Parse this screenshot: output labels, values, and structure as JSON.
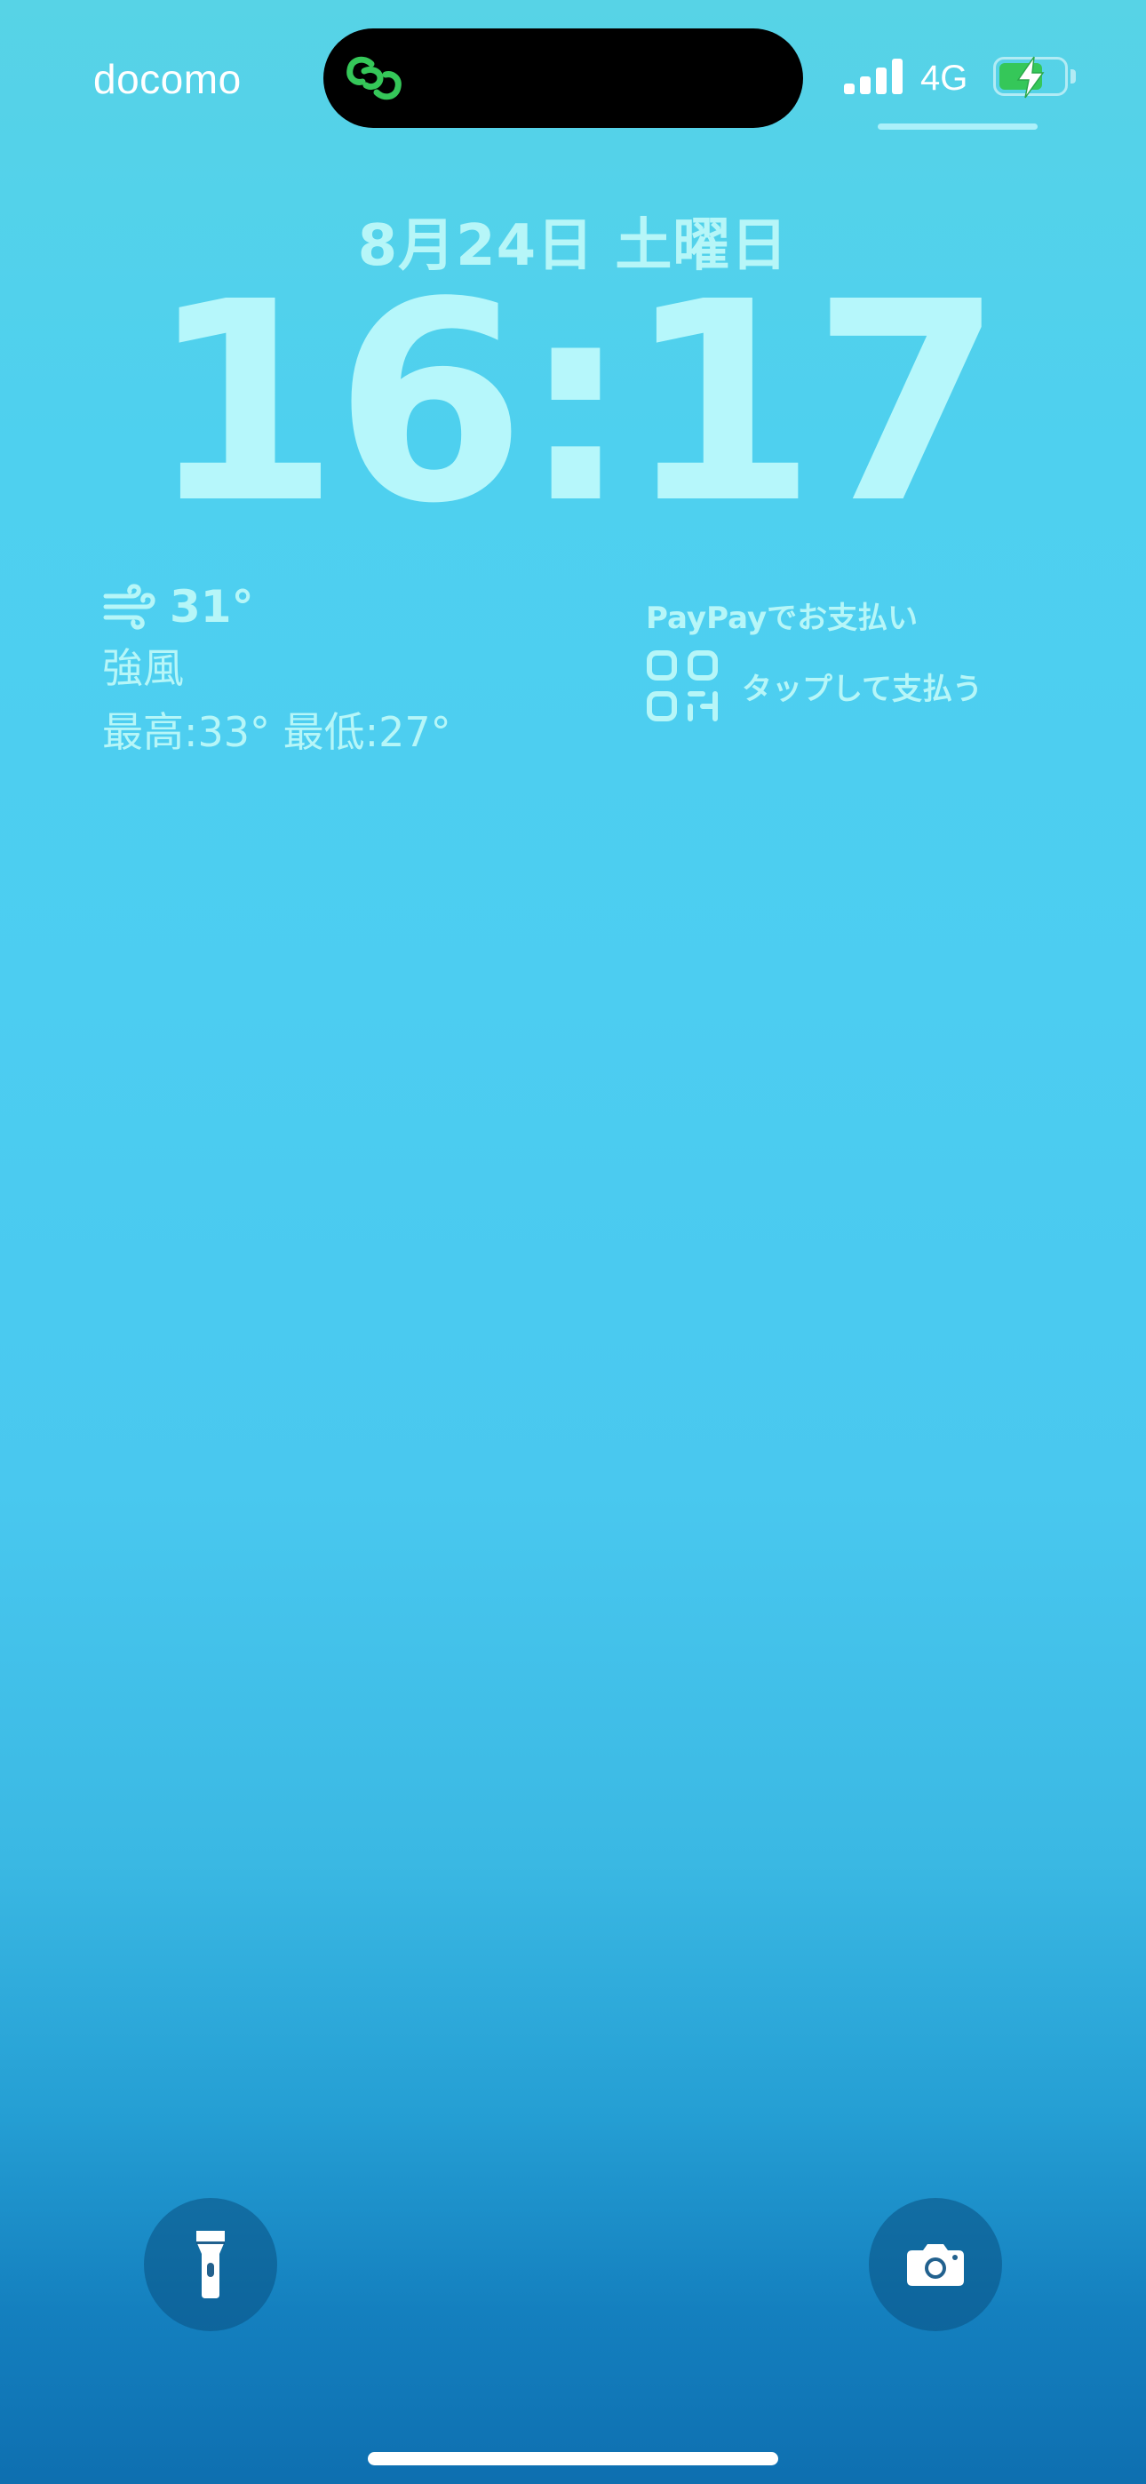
{
  "status_bar": {
    "carrier": "docomo",
    "network": "4G",
    "signal_bars": 4,
    "battery_charging": true,
    "live_activity_icon": "link-chain-icon",
    "colors": {
      "live_activity_accent": "#35c759",
      "battery_fill": "#35c759"
    }
  },
  "lock_screen": {
    "date": "8月24日 土曜日",
    "time": "16:17"
  },
  "widgets": {
    "weather": {
      "icon": "wind-icon",
      "temperature": "31°",
      "condition": "強風",
      "range": "最高:33° 最低:27°"
    },
    "paypay": {
      "title": "PayPayでお支払い",
      "icon": "qr-code-icon",
      "action": "タップして支払う"
    }
  },
  "controls": {
    "left": "flashlight-icon",
    "right": "camera-icon"
  },
  "colors": {
    "accent_text": "#b6f6f8",
    "background_top": "#57d3e6",
    "background_bottom": "#0e6fb0"
  }
}
